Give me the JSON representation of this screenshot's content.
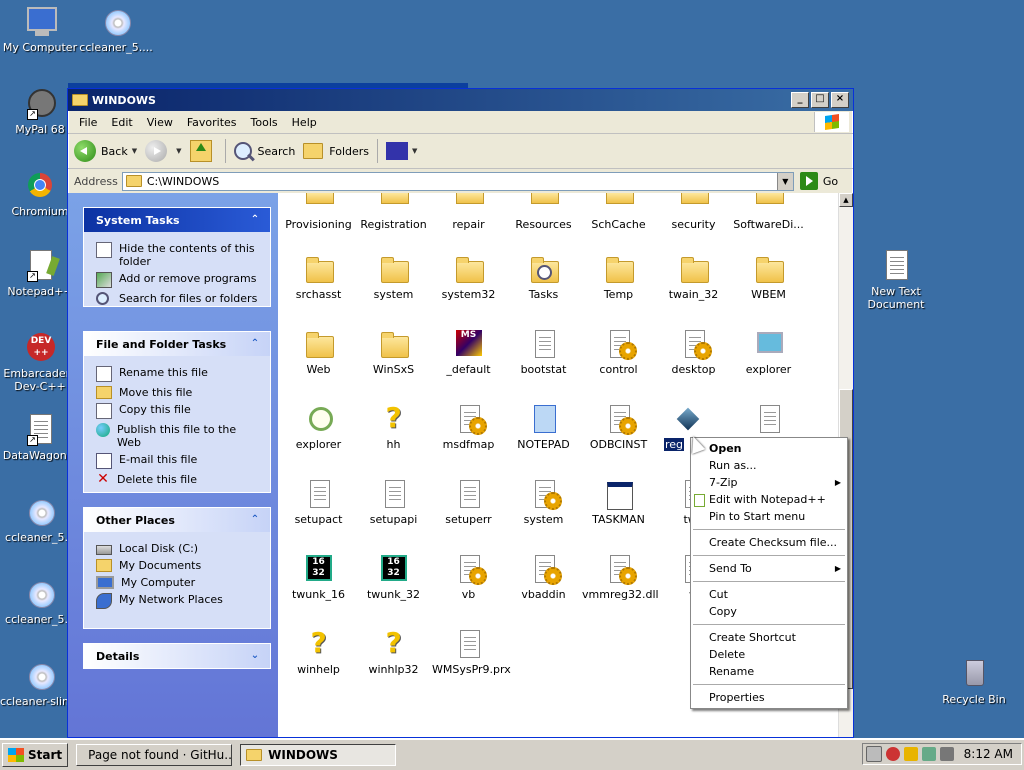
{
  "desktop": {
    "icons": [
      {
        "label": "My Computer",
        "icon": "computer-icon"
      },
      {
        "label": "ccleaner_5....",
        "icon": "installer-disc-icon"
      },
      {
        "label": "MyPal 68",
        "icon": "mypal-browser-icon"
      },
      {
        "label": "Chromium",
        "icon": "chromium-icon"
      },
      {
        "label": "Notepad++",
        "icon": "notepad-plus-plus-icon"
      },
      {
        "label": "Embarcadero Dev-C++",
        "icon": "dev-cpp-icon",
        "label_line1": "Embarcadero",
        "label_line2": "Dev-C++",
        "badge": "DEV\n++"
      },
      {
        "label": "DataWagon...",
        "icon": "document-shortcut-icon"
      },
      {
        "label": "ccleaner_5...",
        "icon": "installer-disc-icon"
      },
      {
        "label": "ccleaner_5...",
        "icon": "installer-disc-icon"
      },
      {
        "label": "ccleaner-slim...",
        "icon": "installer-disc-icon"
      },
      {
        "label": "New Text Document",
        "icon": "text-document-icon",
        "label_line1": "New Text",
        "label_line2": "Document"
      },
      {
        "label": "Recycle Bin",
        "icon": "recycle-bin-icon"
      }
    ]
  },
  "window": {
    "title": "WINDOWS",
    "controls": {
      "minimize": "_",
      "maximize": "□",
      "close": "×"
    },
    "menu": [
      "File",
      "Edit",
      "View",
      "Favorites",
      "Tools",
      "Help"
    ],
    "toolbar": {
      "back": "Back",
      "search": "Search",
      "folders": "Folders"
    },
    "address": {
      "label": "Address",
      "value": "C:\\WINDOWS",
      "go": "Go"
    }
  },
  "sidepanel": {
    "system_tasks": {
      "title": "System Tasks",
      "items": [
        "Hide the contents of this folder",
        "Add or remove programs",
        "Search for files or folders"
      ]
    },
    "file_tasks": {
      "title": "File and Folder Tasks",
      "items": [
        "Rename this file",
        "Move this file",
        "Copy this file",
        "Publish this file to the Web",
        "E-mail this file",
        "Delete this file"
      ]
    },
    "other_places": {
      "title": "Other Places",
      "items": [
        "Local Disk (C:)",
        "My Documents",
        "My Computer",
        "My Network Places"
      ]
    },
    "details": {
      "title": "Details"
    }
  },
  "files": {
    "row1": [
      "Provisioning",
      "Registration",
      "repair",
      "Resources",
      "SchCache",
      "security",
      "SoftwareDi..."
    ],
    "row2": [
      "srchasst",
      "system",
      "system32",
      "Tasks",
      "Temp",
      "twain_32",
      "WBEM"
    ],
    "row3": [
      "Web",
      "WinSxS",
      "_default",
      "bootstat",
      "control",
      "desktop",
      "explorer"
    ],
    "row4": [
      "explorer",
      "hh",
      "msdfmap",
      "NOTEPAD",
      "ODBCINST",
      "reg",
      ""
    ],
    "row5": [
      "setupact",
      "setupapi",
      "setuperr",
      "system",
      "TASKMAN",
      "twa"
    ],
    "row6": [
      "twunk_16",
      "twunk_32",
      "vb",
      "vbaddin",
      "vmmreg32.dll",
      "w"
    ],
    "row7": [
      "winhelp",
      "winhlp32",
      "WMSysPr9.prx"
    ],
    "twunk_badge": "16\n32"
  },
  "context_menu": {
    "open": "Open",
    "run_as": "Run as...",
    "zip": "7-Zip",
    "notepad": "Edit with Notepad++",
    "pin": "Pin to Start menu",
    "checksum": "Create Checksum file...",
    "send_to": "Send To",
    "cut": "Cut",
    "copy": "Copy",
    "shortcut": "Create Shortcut",
    "delete": "Delete",
    "rename": "Rename",
    "properties": "Properties"
  },
  "taskbar": {
    "start": "Start",
    "tasks": [
      {
        "label": "Page not found · GitHu...",
        "active": false
      },
      {
        "label": "WINDOWS",
        "active": true
      }
    ],
    "clock": "8:12 AM"
  },
  "colors": {
    "desktop": "#3a6ea5",
    "selection": "#0a246a",
    "titlebar": "#0a246a"
  }
}
